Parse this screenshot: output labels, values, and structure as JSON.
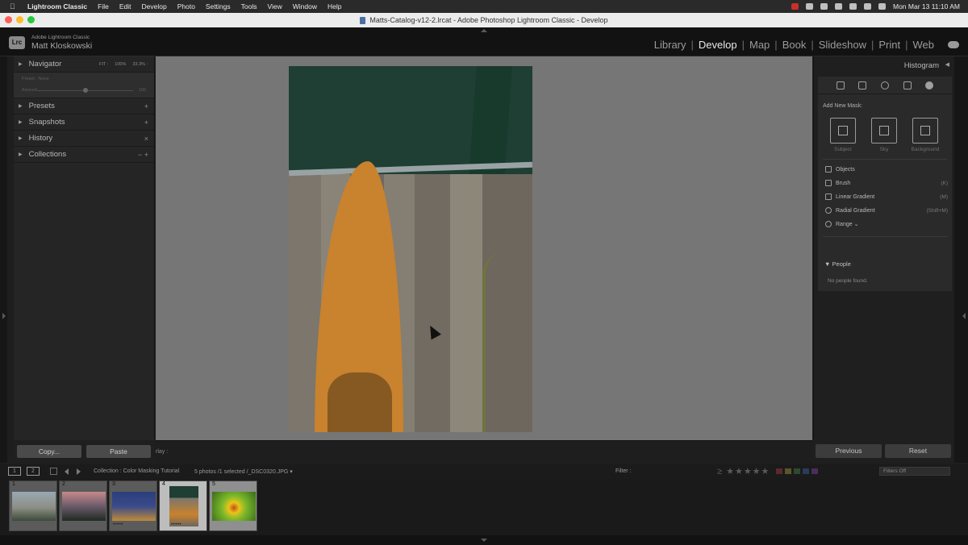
{
  "menubar": {
    "apple": "",
    "app_name": "Lightroom Classic",
    "items": [
      "File",
      "Edit",
      "Develop",
      "Photo",
      "Settings",
      "Tools",
      "View",
      "Window",
      "Help"
    ],
    "clock": "Mon Mar 13  11:10 AM"
  },
  "window": {
    "title": "Matts-Catalog-v12-2.lrcat - Adobe Photoshop Lightroom Classic - Develop"
  },
  "identity": {
    "logo": "Lrc",
    "subtitle": "Adobe Lightroom Classic",
    "user": "Matt Kloskowski"
  },
  "modules": {
    "items": [
      "Library",
      "Develop",
      "Map",
      "Book",
      "Slideshow",
      "Print",
      "Web"
    ],
    "active": "Develop",
    "separator": "|"
  },
  "left_panel": {
    "navigator": {
      "title": "Navigator",
      "zoom_options": [
        "FIT :",
        "100%",
        "33.3% :"
      ],
      "preset_label": "Preset : None",
      "amount_label": "Amount",
      "amount_value": "100"
    },
    "sections": [
      {
        "title": "Presets",
        "control": "+"
      },
      {
        "title": "Snapshots",
        "control": "+"
      },
      {
        "title": "History",
        "control": "×"
      },
      {
        "title": "Collections",
        "control": "− +"
      }
    ],
    "copy_button": "Copy...",
    "paste_button": "Paste"
  },
  "toolbar": {
    "overlay_label": "rlay :"
  },
  "right_panel": {
    "histogram_label": "Histogram",
    "add_new_mask_label": "Add New Mask:",
    "mask_cards": [
      "Subject",
      "Sky",
      "Background"
    ],
    "mask_options": [
      {
        "label": "Objects",
        "key": ""
      },
      {
        "label": "Brush",
        "key": "(K)"
      },
      {
        "label": "Linear Gradient",
        "key": "(M)"
      },
      {
        "label": "Radial Gradient",
        "key": "(Shift+M)"
      },
      {
        "label": "Range ⌄",
        "key": ""
      }
    ],
    "people_header": "People",
    "people_note": "No people found.",
    "previous_button": "Previous",
    "reset_button": "Reset"
  },
  "filmstrip_toolbar": {
    "view_1": "1",
    "view_2": "2",
    "breadcrumb": "Collection : Color Masking Tutorial",
    "selection_info": "5 photos /1 selected /_DSC0320.JPG ▾",
    "filter_label": "Filter :",
    "stars": "≥ ★★★★★",
    "filter_select": "Filters Off"
  },
  "filmstrip": {
    "thumbnails": [
      {
        "number": "1",
        "stars": ""
      },
      {
        "number": "2",
        "stars": ""
      },
      {
        "number": "3",
        "stars": "•••••"
      },
      {
        "number": "4",
        "stars": "•••••"
      },
      {
        "number": "5",
        "stars": ""
      }
    ]
  }
}
